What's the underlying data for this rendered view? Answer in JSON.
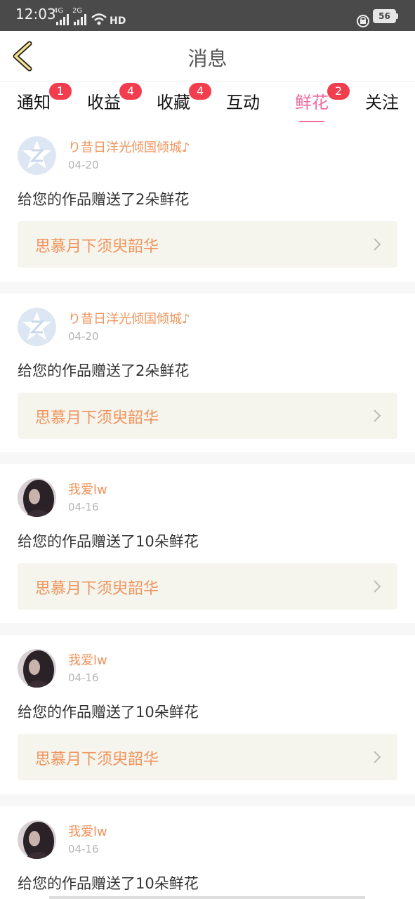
{
  "status_bar": {
    "time": "12:03",
    "net1": "4G",
    "net2": "2G",
    "hd": "HD",
    "battery": "56"
  },
  "header": {
    "title": "消息"
  },
  "tabs": [
    {
      "label": "通知",
      "badge": "1",
      "active": false
    },
    {
      "label": "收益",
      "badge": "4",
      "active": false
    },
    {
      "label": "收藏",
      "badge": "4",
      "active": false
    },
    {
      "label": "互动",
      "badge": "",
      "active": false
    },
    {
      "label": "鲜花",
      "badge": "2",
      "active": true
    },
    {
      "label": "关注",
      "badge": "",
      "active": false
    }
  ],
  "colors": {
    "accent": "#f06aa0",
    "name": "#f0935a",
    "badge": "#f23d4e",
    "card_bg": "#f5f5ee"
  },
  "messages": [
    {
      "avatar": "z-badge-avatar",
      "user": "り昔日洋光倾国倾城♪",
      "date": "04-20",
      "text": "给您的作品赠送了2朵鲜花",
      "work": "思慕月下须臾韶华"
    },
    {
      "avatar": "z-badge-avatar",
      "user": "り昔日洋光倾国倾城♪",
      "date": "04-20",
      "text": "给您的作品赠送了2朵鲜花",
      "work": "思慕月下须臾韶华"
    },
    {
      "avatar": "photo-avatar",
      "user": "我爱lw",
      "date": "04-16",
      "text": "给您的作品赠送了10朵鲜花",
      "work": "思慕月下须臾韶华"
    },
    {
      "avatar": "photo-avatar",
      "user": "我爱lw",
      "date": "04-16",
      "text": "给您的作品赠送了10朵鲜花",
      "work": "思慕月下须臾韶华"
    },
    {
      "avatar": "photo-avatar",
      "user": "我爱lw",
      "date": "04-16",
      "text": "给您的作品赠送了10朵鲜花",
      "work": ""
    }
  ]
}
